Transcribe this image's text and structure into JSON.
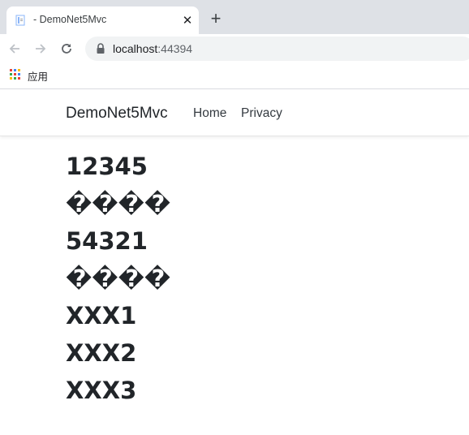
{
  "browser": {
    "tab": {
      "title": "- DemoNet5Mvc",
      "favicon": "document-icon",
      "close_symbol": "✕"
    },
    "new_tab_symbol": "+",
    "address": {
      "host": "localhost",
      "port": ":44394"
    },
    "bookmarks": [
      {
        "label": "应用",
        "icon": "apps-grid-icon"
      }
    ]
  },
  "site": {
    "brand": "DemoNet5Mvc",
    "nav": [
      {
        "label": "Home"
      },
      {
        "label": "Privacy"
      }
    ]
  },
  "content": {
    "lines": [
      "12345",
      "����",
      "54321",
      "����",
      "XXX1",
      "XXX2",
      "XXX3"
    ]
  },
  "colors": {
    "tabstrip_bg": "#dee1e6",
    "omnibox_bg": "#f1f3f4",
    "text": "#212529"
  }
}
